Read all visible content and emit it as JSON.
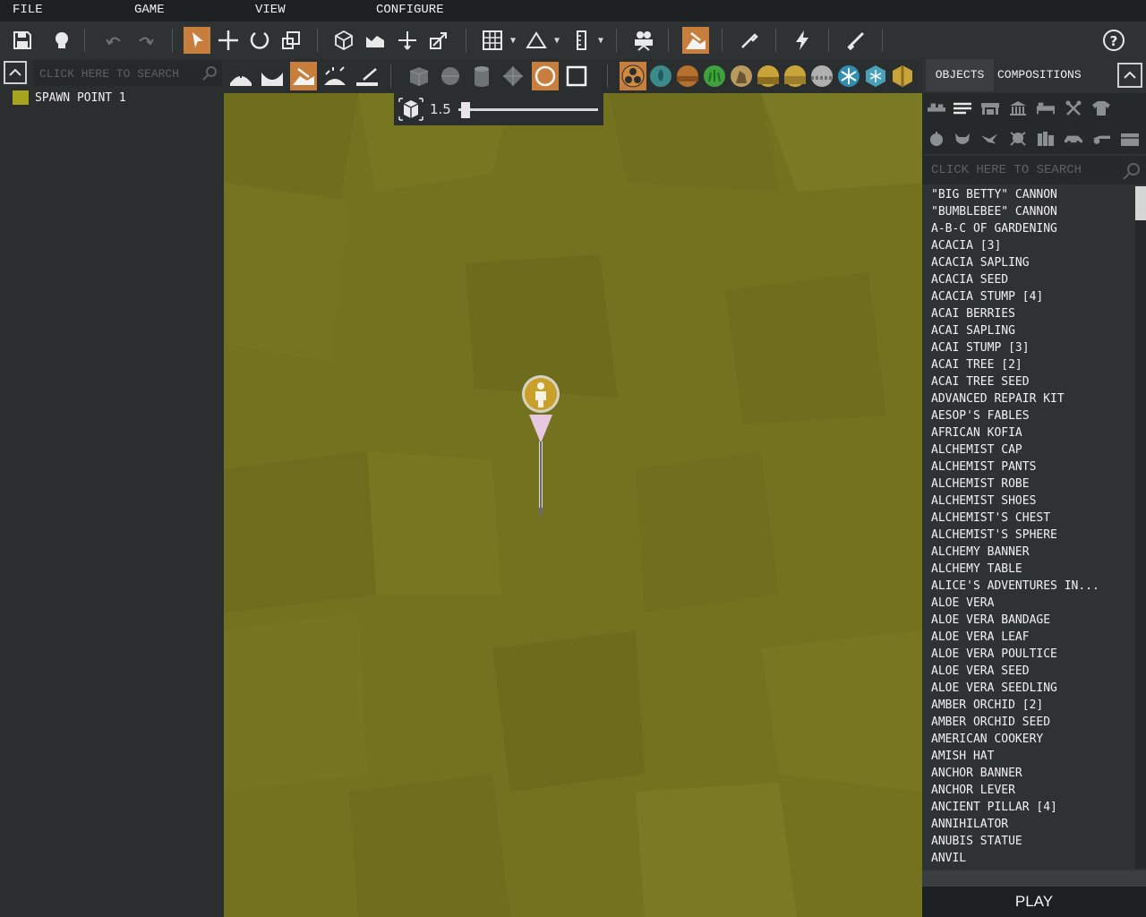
{
  "menu": {
    "file": "FILE",
    "game": "GAME",
    "view": "VIEW",
    "configure": "CONFIGURE"
  },
  "toolbar": {
    "icons": [
      "save-icon",
      "lightbulb-icon",
      "undo-icon",
      "redo-icon",
      "select-arrow-icon",
      "move-icon",
      "rotate-icon",
      "scale-icon",
      "cube-icon",
      "terrain-icon",
      "snap-cross-icon",
      "local-transform-icon",
      "grid-icon",
      "angle-icon",
      "ruler-icon",
      "camera-icon",
      "terrain-paint-icon",
      "eyedropper-icon",
      "lightning-icon",
      "brush-icon",
      "help-icon"
    ],
    "active_tools": [
      "select-arrow-icon",
      "terrain-paint-icon"
    ]
  },
  "left_panel": {
    "search_placeholder": "CLICK HERE TO SEARCH",
    "items": [
      {
        "label": "SPAWN POINT 1",
        "color": "#a6a31f"
      }
    ]
  },
  "terrain_toolbar": {
    "brush_size": "1.5",
    "brush_level": 0.02,
    "active_tools": [
      "raise-terrain-icon",
      "ring-brush-icon"
    ],
    "material_colors": [
      "#c87f3d",
      "#3d8a8a",
      "#b8702e",
      "#3ea33e",
      "#b89a5e",
      "#c9a43a",
      "#c9a43a",
      "#b0b0b0",
      "#2f8fb0",
      "#4aa0b8",
      "#c9a43a"
    ]
  },
  "right_panel": {
    "tab_objects": "OBJECTS",
    "tab_compositions": "COMPOSITIONS",
    "search_placeholder": "CLICK HERE TO SEARCH",
    "objects": [
      "\"BIG BETTY\" CANNON",
      "\"BUMBLEBEE\" CANNON",
      "A-B-C OF GARDENING",
      "ACACIA [3]",
      "ACACIA SAPLING",
      "ACACIA SEED",
      "ACACIA STUMP [4]",
      "ACAI BERRIES",
      "ACAI SAPLING",
      "ACAI STUMP [3]",
      "ACAI TREE [2]",
      "ACAI TREE SEED",
      "ADVANCED REPAIR KIT",
      "AESOP'S FABLES",
      "AFRICAN KOFIA",
      "ALCHEMIST CAP",
      "ALCHEMIST PANTS",
      "ALCHEMIST ROBE",
      "ALCHEMIST SHOES",
      "ALCHEMIST'S CHEST",
      "ALCHEMIST'S SPHERE",
      "ALCHEMY BANNER",
      "ALCHEMY TABLE",
      "ALICE'S ADVENTURES IN...",
      "ALOE VERA",
      "ALOE VERA BANDAGE",
      "ALOE VERA LEAF",
      "ALOE VERA POULTICE",
      "ALOE VERA SEED",
      "ALOE VERA SEEDLING",
      "AMBER ORCHID [2]",
      "AMBER ORCHID SEED",
      "AMERICAN COOKERY",
      "AMISH HAT",
      "ANCHOR BANNER",
      "ANCHOR LEVER",
      "ANCIENT PILLAR [4]",
      "ANNIHILATOR",
      "ANUBIS STATUE",
      "ANVIL"
    ],
    "play": "PLAY"
  },
  "colors": {
    "accent": "#c87f3d",
    "terrain": "#73731f",
    "spawn_marker": "#c9a02a"
  }
}
